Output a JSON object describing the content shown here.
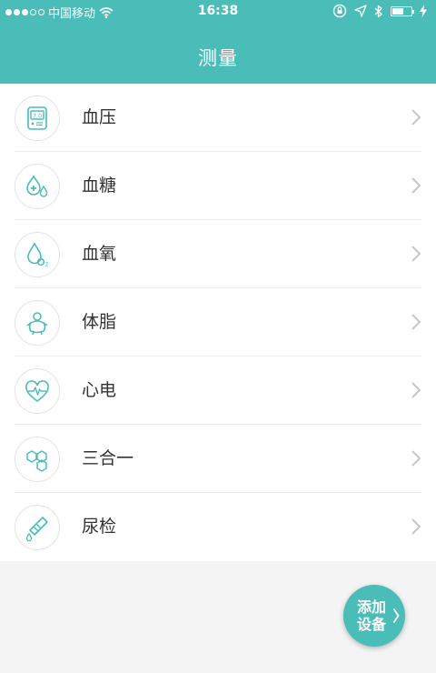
{
  "status_bar": {
    "carrier": "中国移动",
    "time": "16:38",
    "signal_dots_filled": 3,
    "signal_dots_total": 5,
    "battery_level": 0.6
  },
  "header": {
    "title": "测量"
  },
  "measure_list": [
    {
      "label": "血压",
      "icon": "blood-pressure-monitor-icon"
    },
    {
      "label": "血糖",
      "icon": "blood-sugar-drop-icon"
    },
    {
      "label": "血氧",
      "icon": "blood-oxygen-drop-icon"
    },
    {
      "label": "体脂",
      "icon": "body-fat-figure-icon"
    },
    {
      "label": "心电",
      "icon": "ecg-heart-icon"
    },
    {
      "label": "三合一",
      "icon": "three-in-one-hexagon-icon"
    },
    {
      "label": "尿检",
      "icon": "urine-test-strip-icon"
    }
  ],
  "fab": {
    "label": "添加设备",
    "icon": "chevron-right-icon"
  },
  "colors": {
    "accent": "#4bbdb9",
    "background": "#f4f4f4",
    "text": "#333333",
    "chevron": "#c7c7c7"
  }
}
